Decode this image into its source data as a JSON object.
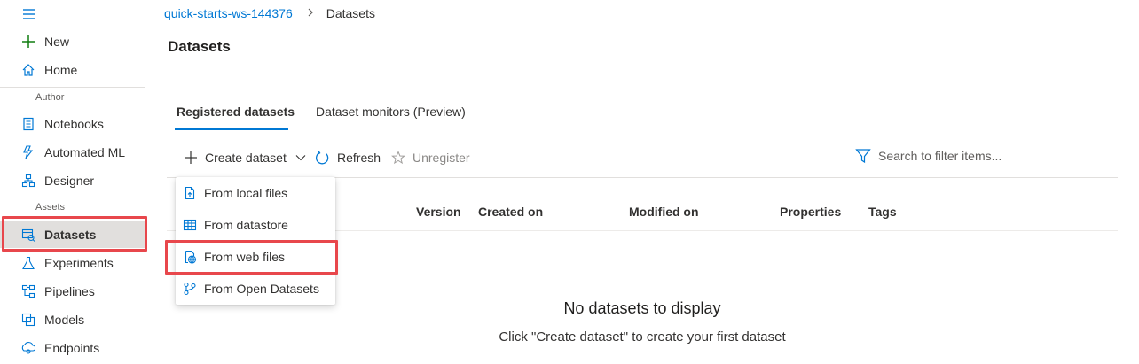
{
  "sidebar": {
    "items_top": [
      {
        "label": "New",
        "icon": "plus-icon"
      },
      {
        "label": "Home",
        "icon": "home-icon"
      }
    ],
    "author_label": "Author",
    "author_items": [
      {
        "label": "Notebooks",
        "icon": "notebook-icon"
      },
      {
        "label": "Automated ML",
        "icon": "automated-ml-icon"
      },
      {
        "label": "Designer",
        "icon": "designer-icon"
      }
    ],
    "assets_label": "Assets",
    "assets_items": [
      {
        "label": "Datasets",
        "icon": "datasets-icon",
        "active": true
      },
      {
        "label": "Experiments",
        "icon": "flask-icon"
      },
      {
        "label": "Pipelines",
        "icon": "pipeline-icon"
      },
      {
        "label": "Models",
        "icon": "models-icon"
      },
      {
        "label": "Endpoints",
        "icon": "endpoints-icon"
      }
    ]
  },
  "breadcrumb": {
    "workspace": "quick-starts-ws-144376",
    "current": "Datasets"
  },
  "page": {
    "title": "Datasets"
  },
  "tabs": [
    {
      "label": "Registered datasets",
      "active": true
    },
    {
      "label": "Dataset monitors (Preview)",
      "active": false
    }
  ],
  "toolbar": {
    "create_label": "Create dataset",
    "refresh_label": "Refresh",
    "unregister_label": "Unregister"
  },
  "search": {
    "placeholder": "Search to filter items..."
  },
  "table": {
    "columns": [
      "Version",
      "Created on",
      "Modified on",
      "Properties",
      "Tags"
    ]
  },
  "empty_state": {
    "title": "No datasets to display",
    "subtitle": "Click \"Create dataset\" to create your first dataset"
  },
  "create_menu": {
    "items": [
      {
        "label": "From local files",
        "icon": "upload-file-icon"
      },
      {
        "label": "From datastore",
        "icon": "table-icon"
      },
      {
        "label": "From web files",
        "icon": "globe-file-icon",
        "highlighted": true
      },
      {
        "label": "From Open Datasets",
        "icon": "branch-icon"
      }
    ]
  },
  "colors": {
    "accent": "#0078d4",
    "highlight": "#e8474c",
    "active_nav_bg": "#e1dfdd",
    "new_icon": "#107c10"
  }
}
